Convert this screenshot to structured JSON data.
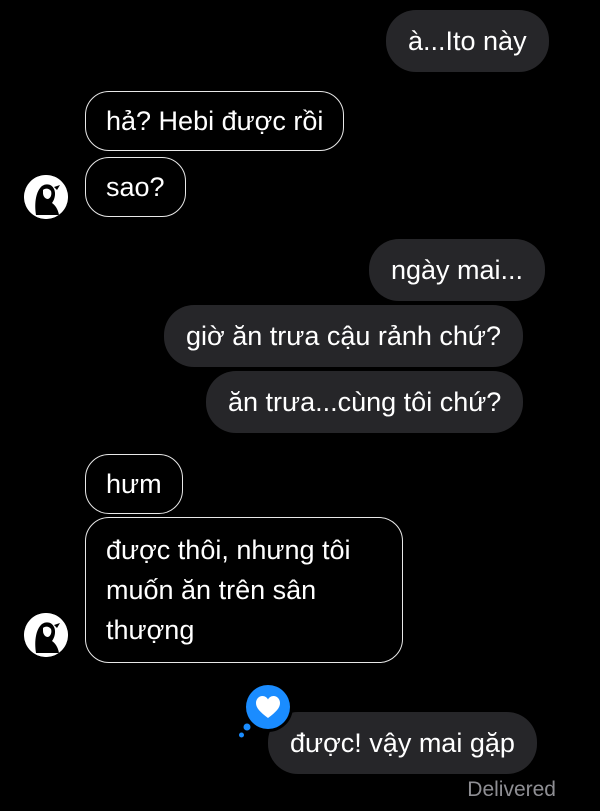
{
  "messages": {
    "m1": "à...Ito này",
    "m2": "hả? Hebi được rồi",
    "m3": "sao?",
    "m4": "ngày mai...",
    "m5": "giờ ăn trưa cậu rảnh chứ?",
    "m6": "ăn trưa...cùng tôi chứ?",
    "m7": "hưm",
    "m8": "được thôi, nhưng tôi muốn ăn trên sân thượng",
    "m9": "được! vậy mai gặp"
  },
  "status": {
    "delivered": "Delivered"
  },
  "reaction": {
    "icon": "heart-icon",
    "color": "#1a8cff"
  },
  "colors": {
    "sent_bubble": "#262629",
    "received_border": "#e8e8e8",
    "background": "#000000"
  }
}
